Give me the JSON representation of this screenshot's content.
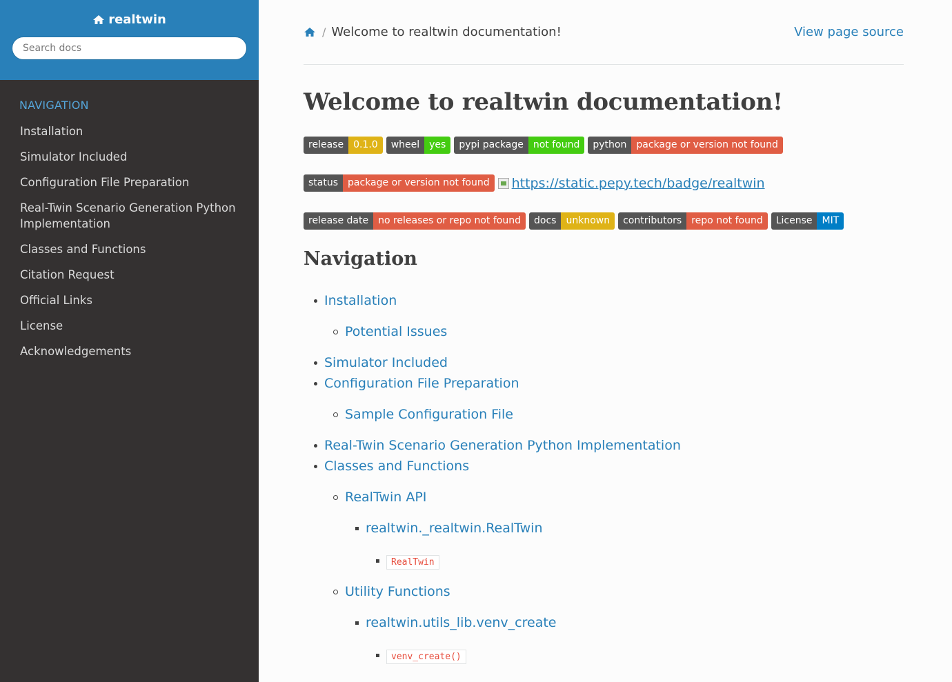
{
  "project": {
    "name": "realtwin"
  },
  "search": {
    "placeholder": "Search docs"
  },
  "sidebar": {
    "caption": "NAVIGATION",
    "items": [
      "Installation",
      "Simulator Included",
      "Configuration File Preparation",
      "Real-Twin Scenario Generation Python Implementation",
      "Classes and Functions",
      "Citation Request",
      "Official Links",
      "License",
      "Acknowledgements"
    ]
  },
  "breadcrumb": {
    "current": "Welcome to realtwin documentation!",
    "view_source": "View page source"
  },
  "page": {
    "title": "Welcome to realtwin documentation!",
    "nav_heading": "Navigation"
  },
  "badges": {
    "row1": [
      {
        "left": "release",
        "right": "0.1.0",
        "color": "#dfb317"
      },
      {
        "left": "wheel",
        "right": "yes",
        "color": "#4c1"
      },
      {
        "left": "pypi package",
        "right": "not found",
        "color": "#4c1"
      },
      {
        "left": "python",
        "right": "package or version not found",
        "color": "#e05d44"
      }
    ],
    "row2": [
      {
        "left": "status",
        "right": "package or version not found",
        "color": "#e05d44"
      }
    ],
    "row2_img_alt": "https://static.pepy.tech/badge/realtwin",
    "row3": [
      {
        "left": "release date",
        "right": "no releases or repo not found",
        "color": "#e05d44"
      },
      {
        "left": "docs",
        "right": "unknown",
        "color": "#dfb317"
      },
      {
        "left": "contributors",
        "right": "repo not found",
        "color": "#e05d44"
      },
      {
        "left": "License",
        "right": "MIT",
        "color": "#007ec6"
      }
    ]
  },
  "toc": {
    "installation": "Installation",
    "potential_issues": "Potential Issues",
    "simulator_included": "Simulator Included",
    "config_prep": "Configuration File Preparation",
    "sample_config": "Sample Configuration File",
    "real_twin_impl": "Real-Twin Scenario Generation Python Implementation",
    "classes_functions": "Classes and Functions",
    "realtwin_api": "RealTwin API",
    "realtwin_class_module": "realtwin._realtwin.RealTwin",
    "realtwin_code": "RealTwin",
    "utility_functions": "Utility Functions",
    "venv_module": "realtwin.utils_lib.venv_create",
    "venv_code": "venv_create()"
  }
}
